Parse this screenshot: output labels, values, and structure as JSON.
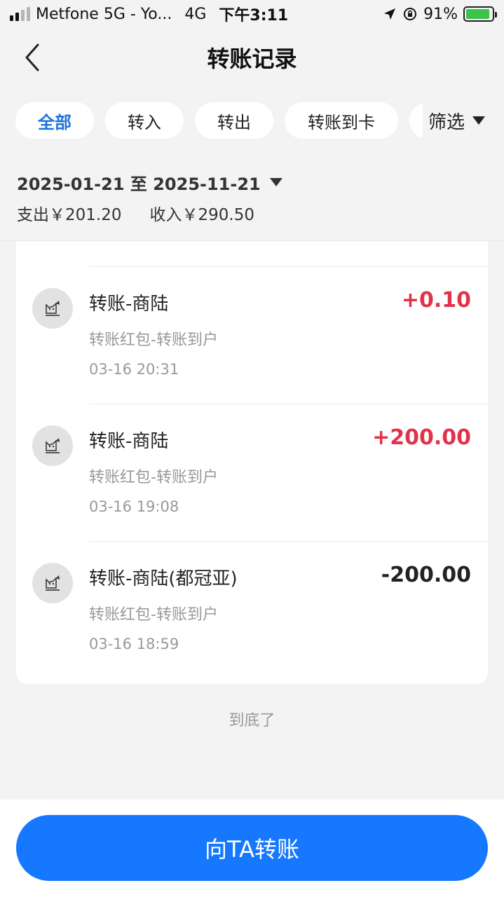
{
  "status_bar": {
    "carrier": "Metfone 5G - Yo...",
    "network": "4G",
    "time": "下午3:11",
    "battery": "91%",
    "battery_level": 0.91
  },
  "nav": {
    "title": "转账记录"
  },
  "filters": {
    "tabs": [
      {
        "label": "全部",
        "active": true
      },
      {
        "label": "转入",
        "active": false
      },
      {
        "label": "转出",
        "active": false
      },
      {
        "label": "转账到卡",
        "active": false
      }
    ],
    "filter_label": "筛选"
  },
  "date_range": "2025-01-21 至 2025-11-21",
  "summary": {
    "expense": "支出￥201.20",
    "income": "收入￥290.50"
  },
  "records": [
    {
      "title": "转账-商陆",
      "subtitle": "转账红包-转账到户",
      "time": "03-16 20:31",
      "amount": "+0.10",
      "direction": "in"
    },
    {
      "title": "转账-商陆",
      "subtitle": "转账红包-转账到户",
      "time": "03-16 19:08",
      "amount": "+200.00",
      "direction": "in"
    },
    {
      "title": "转账-商陆(都冠亚)",
      "subtitle": "转账红包-转账到户",
      "time": "03-16 18:59",
      "amount": "-200.00",
      "direction": "out"
    }
  ],
  "end_text": "到底了",
  "bottom": {
    "button_label": "向TA转账"
  },
  "colors": {
    "accent": "#1677ff",
    "active_tab": "#1a73d9",
    "positive": "#e0334a",
    "battery": "#3cc34a"
  },
  "icons": {
    "back": "chevron-left-icon",
    "dropdown": "triangle-down-icon",
    "location": "location-arrow-icon",
    "lock": "rotation-lock-icon",
    "avatar": "cat-avatar-icon"
  }
}
